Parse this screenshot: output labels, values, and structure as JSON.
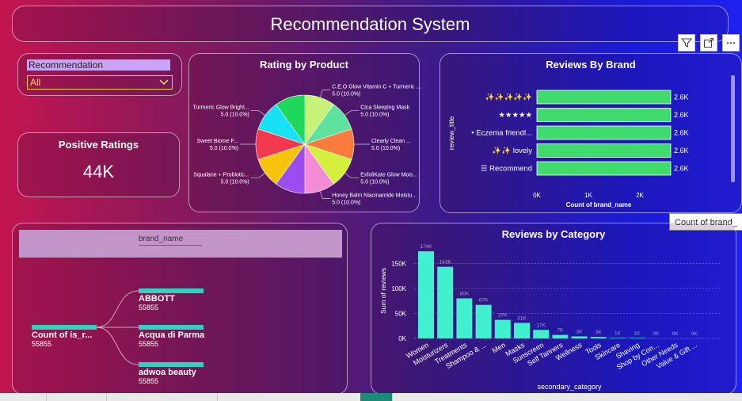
{
  "header": {
    "title": "Recommendation System"
  },
  "visual_header": {
    "filter_icon": "filter-icon",
    "focus_icon": "focus-mode-icon",
    "more_icon": "more-options-icon",
    "more_label": "⋯"
  },
  "tooltip": {
    "text": "Count of brand_"
  },
  "slicer": {
    "label": "Recommendation",
    "value": "All"
  },
  "kpi": {
    "title": "Positive Ratings",
    "value": "44K"
  },
  "pie": {
    "title": "Rating by Product",
    "chart_data": {
      "type": "pie",
      "title": "Rating by Product",
      "slices": [
        {
          "label": "C.E.O Glow Vitamin C + Turmeric ...",
          "value_label": "5.0 (10.0%)",
          "value": 10,
          "color": "#c7f27a"
        },
        {
          "label": "Cica Sleeping Mask",
          "value_label": "5.0 (10.0%)",
          "value": 10,
          "color": "#5ee39e"
        },
        {
          "label": "Clearly Clean ...",
          "value_label": "5.0 (10.0%)",
          "value": 10,
          "color": "#fb7b3c"
        },
        {
          "label": "ExfoliKate Glow Mois...",
          "value_label": "5.0 (10.0%)",
          "value": 10,
          "color": "#d4f03a"
        },
        {
          "label": "Honey Balm Niacinamide Moistu...",
          "value_label": "5.0 (10.0%)",
          "value": 10,
          "color": "#f38bd6"
        },
        {
          "label": "",
          "value_label": "",
          "value": 10,
          "color": "#9b4df0"
        },
        {
          "label": "Squalane + Probiotic...",
          "value_label": "5.0 (10.0%)",
          "value": 10,
          "color": "#f8c40a"
        },
        {
          "label": "Sweet Biome F...",
          "value_label": "5.0 (10.0%)",
          "value": 10,
          "color": "#f2384c"
        },
        {
          "label": "Turmeric Glow Bright...",
          "value_label": "5.0 (10.0%)",
          "value": 10,
          "color": "#17e1f5"
        },
        {
          "label": "",
          "value_label": "",
          "value": 10,
          "color": "#1ed85a"
        }
      ]
    }
  },
  "brand_chart": {
    "title": "Reviews By Brand",
    "chart_data": {
      "type": "bar",
      "orientation": "horizontal",
      "categories": [
        "✨✨✨✨✨",
        "★★★★★",
        "• Eczema friendl...",
        "✨✨ lovely",
        "☰ Recommend"
      ],
      "values": [
        2.6,
        2.6,
        2.6,
        2.6,
        2.6
      ],
      "data_labels": [
        "2.6K",
        "2.6K",
        "2.6K",
        "2.6K",
        "2.6K"
      ],
      "xticks": [
        "0K",
        "1K",
        "2K"
      ],
      "xlim": [
        0,
        3.2
      ],
      "xlabel": "Count of brand_name",
      "ylabel": "review_title",
      "bar_color": "#3fdc6d"
    }
  },
  "tree": {
    "header": "brand_name",
    "root": {
      "label": "Count of is_r...",
      "value": "55855"
    },
    "children": [
      {
        "label": "ABBOTT",
        "value": "55855"
      },
      {
        "label": "Acqua di Parma",
        "value": "55855"
      },
      {
        "label": "adwoa beauty",
        "value": "55855"
      }
    ],
    "bar_color": "#2fd3c0"
  },
  "category_chart": {
    "title": "Reviews by Category",
    "chart_data": {
      "type": "bar",
      "categories": [
        "Women",
        "Moisturizers",
        "Treatments",
        "Shampoo & ...",
        "Men",
        "Masks",
        "Sunscreen",
        "Self Tanners",
        "Wellness",
        "Tools",
        "Skincare",
        "Shaving",
        "Shop by Con...",
        "Other Needs",
        "Value & Gift ..."
      ],
      "values": [
        174,
        143,
        80,
        67,
        37,
        31,
        17,
        7,
        4,
        3,
        1,
        1,
        0,
        0,
        0
      ],
      "data_labels": [
        "174K",
        "143K",
        "80K",
        "67K",
        "37K",
        "31K",
        "17K",
        "7K",
        "3K",
        "3K",
        "1K",
        "1K",
        "0K",
        "0K",
        "0K"
      ],
      "yticks": [
        "0K",
        "50K",
        "100K",
        "150K"
      ],
      "ylim": [
        0,
        190
      ],
      "xlabel": "secondary_category",
      "ylabel": "Sum of reviews",
      "bar_color": "#40f0cf"
    }
  }
}
